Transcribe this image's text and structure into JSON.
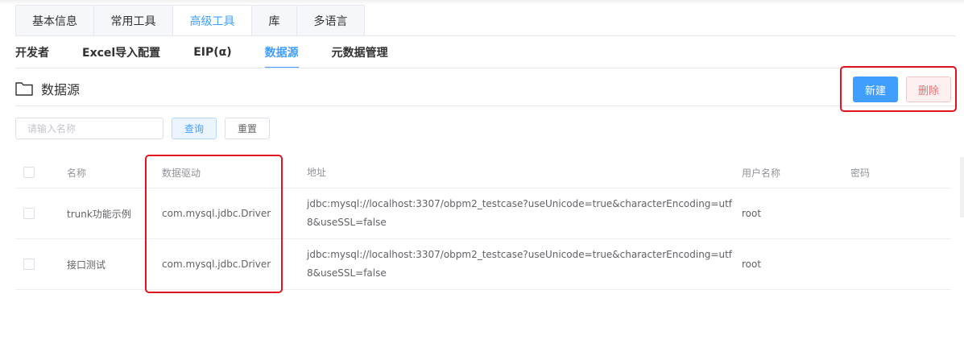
{
  "top_tabs": [
    {
      "label": "基本信息",
      "active": false
    },
    {
      "label": "常用工具",
      "active": false
    },
    {
      "label": "高级工具",
      "active": true
    },
    {
      "label": "库",
      "active": false
    },
    {
      "label": "多语言",
      "active": false
    }
  ],
  "sub_tabs": [
    {
      "label": "开发者",
      "active": false
    },
    {
      "label": "Excel导入配置",
      "active": false
    },
    {
      "label": "EIP(α)",
      "active": false
    },
    {
      "label": "数据源",
      "active": true
    },
    {
      "label": "元数据管理",
      "active": false
    }
  ],
  "section": {
    "title": "数据源",
    "icon": "folder-icon"
  },
  "toolbar": {
    "new_label": "新建",
    "delete_label": "删除"
  },
  "search": {
    "placeholder": "请输入名称",
    "value": "",
    "query_label": "查询",
    "reset_label": "重置"
  },
  "table": {
    "columns": [
      "名称",
      "数据驱动",
      "地址",
      "用户名称",
      "密码"
    ],
    "rows": [
      {
        "name": "trunk功能示例",
        "driver": "com.mysql.jdbc.Driver",
        "url": "jdbc:mysql://localhost:3307/obpm2_testcase?useUnicode=true&characterEncoding=utf8&useSSL=false",
        "user": "root",
        "password": ""
      },
      {
        "name": "接口测试",
        "driver": "com.mysql.jdbc.Driver",
        "url": "jdbc:mysql://localhost:3307/obpm2_testcase?useUnicode=true&characterEncoding=utf8&useSSL=false",
        "user": "root",
        "password": ""
      }
    ]
  },
  "colors": {
    "accent": "#409eff",
    "danger": "#f56c6c",
    "annotation": "#e0141e"
  }
}
